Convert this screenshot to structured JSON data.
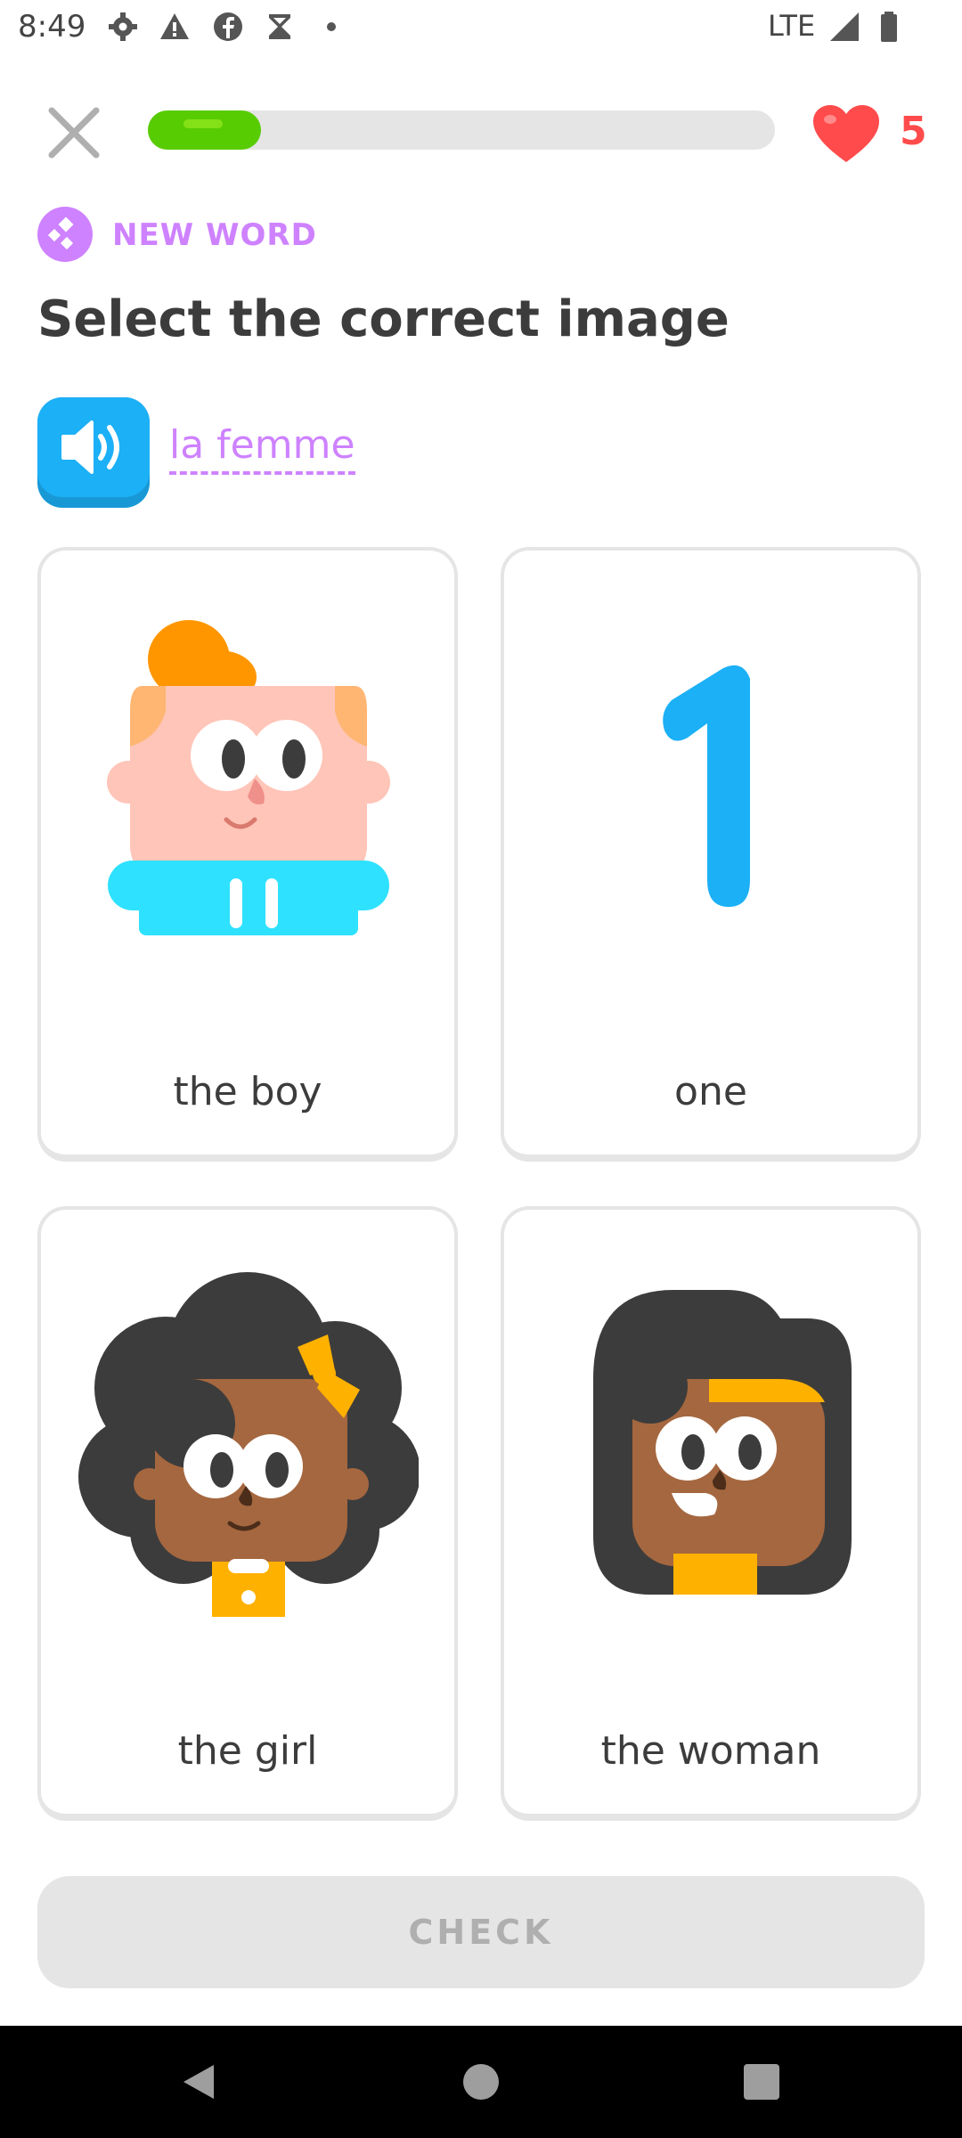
{
  "status_bar": {
    "time": "8:49",
    "network": "LTE",
    "icons": [
      "gear-icon",
      "warning-icon",
      "facebook-icon",
      "hourglass-icon",
      "dot-icon",
      "signal-icon",
      "battery-icon"
    ]
  },
  "lesson": {
    "progress": 0.18,
    "hearts": "5",
    "badge": "NEW WORD",
    "instruction": "Select the correct image",
    "phrase": "la femme"
  },
  "choices": [
    {
      "label": "the boy",
      "icon": "boy-illustration"
    },
    {
      "label": "one",
      "icon": "number-one-illustration"
    },
    {
      "label": "the girl",
      "icon": "girl-illustration"
    },
    {
      "label": "the woman",
      "icon": "woman-illustration"
    }
  ],
  "check_button": "CHECK",
  "colors": {
    "progress": "#58cc02",
    "heart": "#ff4b4b",
    "accent_purple": "#ce82ff",
    "speaker_blue": "#1cb0f6",
    "disabled_button": "#e5e5e5"
  }
}
